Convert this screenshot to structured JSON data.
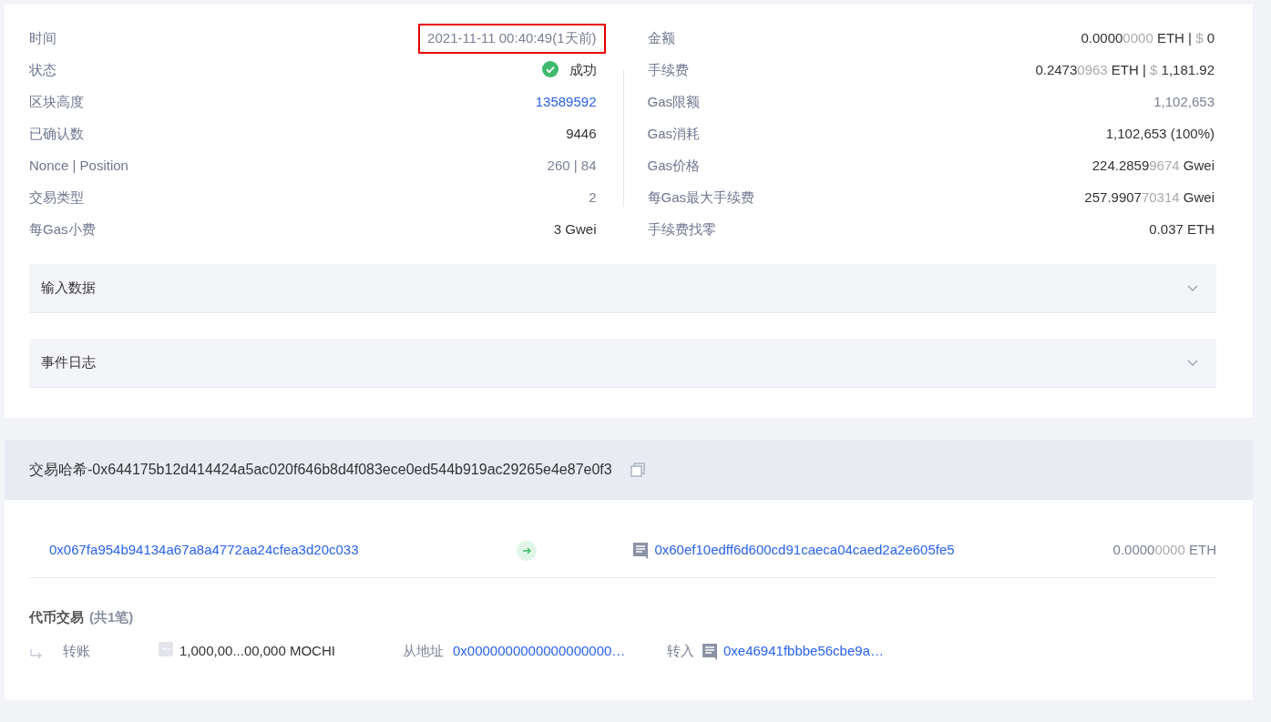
{
  "overview": {
    "left": [
      {
        "label": "时间",
        "kind": "plain",
        "muted": true,
        "highlighted": true,
        "parts": [
          {
            "text": "2021-11-11 00:40:49(1天前)",
            "faint": false
          }
        ]
      },
      {
        "label": "状态",
        "kind": "status",
        "muted": false,
        "highlighted": false,
        "parts": [
          {
            "text": "成功",
            "faint": false
          }
        ]
      },
      {
        "label": "区块高度",
        "kind": "link",
        "highlighted": false,
        "parts": [
          {
            "text": "13589592",
            "faint": false
          }
        ]
      },
      {
        "label": "已确认数",
        "kind": "plain",
        "muted": false,
        "highlighted": false,
        "parts": [
          {
            "text": "9446",
            "faint": false
          }
        ]
      },
      {
        "label": "Nonce | Position",
        "kind": "plain",
        "muted": true,
        "highlighted": false,
        "parts": [
          {
            "text": "260 | 84",
            "faint": false
          }
        ]
      },
      {
        "label": "交易类型",
        "kind": "plain",
        "muted": true,
        "highlighted": false,
        "parts": [
          {
            "text": "2",
            "faint": false
          }
        ]
      },
      {
        "label": "每Gas小费",
        "kind": "plain",
        "muted": false,
        "highlighted": false,
        "parts": [
          {
            "text": "3 Gwei",
            "faint": false
          }
        ]
      }
    ],
    "right": [
      {
        "label": "金额",
        "kind": "plain",
        "muted": false,
        "highlighted": false,
        "parts": [
          {
            "text": "0.0000",
            "faint": false
          },
          {
            "text": "0000",
            "faint": true
          },
          {
            "text": " ETH | ",
            "faint": false
          },
          {
            "text": "$",
            "faint": true
          },
          {
            "text": " 0",
            "faint": false
          }
        ]
      },
      {
        "label": "手续费",
        "kind": "plain",
        "muted": false,
        "highlighted": false,
        "parts": [
          {
            "text": "0.2473",
            "faint": false
          },
          {
            "text": "0963",
            "faint": true
          },
          {
            "text": " ETH | ",
            "faint": false
          },
          {
            "text": "$",
            "faint": true
          },
          {
            "text": " 1,181.92",
            "faint": false
          }
        ]
      },
      {
        "label": "Gas限额",
        "kind": "plain",
        "muted": true,
        "highlighted": false,
        "parts": [
          {
            "text": "1,102,653",
            "faint": false
          }
        ]
      },
      {
        "label": "Gas消耗",
        "kind": "plain",
        "muted": false,
        "highlighted": false,
        "parts": [
          {
            "text": "1,102,653 (100%)",
            "faint": false
          }
        ]
      },
      {
        "label": "Gas价格",
        "kind": "plain",
        "muted": false,
        "highlighted": false,
        "parts": [
          {
            "text": "224.2859",
            "faint": false
          },
          {
            "text": "9674",
            "faint": true
          },
          {
            "text": " Gwei",
            "faint": false
          }
        ]
      },
      {
        "label": "每Gas最大手续费",
        "kind": "plain",
        "muted": false,
        "highlighted": false,
        "parts": [
          {
            "text": "257.9907",
            "faint": false
          },
          {
            "text": "70314",
            "faint": true
          },
          {
            "text": " Gwei",
            "faint": false
          }
        ]
      },
      {
        "label": "手续费找零",
        "kind": "plain",
        "muted": false,
        "highlighted": false,
        "parts": [
          {
            "text": "0.037 ETH",
            "faint": false
          }
        ]
      }
    ]
  },
  "panels": [
    {
      "title": "输入数据",
      "expanded": false
    },
    {
      "title": "事件日志",
      "expanded": false
    }
  ],
  "transaction": {
    "hash_title": "交易哈希-0x644175b12d414424a5ac020f646b8d4f083ece0ed544b919ac29265e4e87e0f3",
    "from": "0x067fa954b94134a67a8a4772aa24cfea3d20c033",
    "to": "0x60ef10edff6d600cd91caeca04caed2a2e605fe5",
    "value": [
      {
        "text": "0.0000",
        "faint": false
      },
      {
        "text": "0000",
        "faint": true
      },
      {
        "text": " ETH",
        "faint": false
      }
    ]
  },
  "token_transfers": {
    "title": "代币交易",
    "count": "(共1笔)",
    "rows": [
      {
        "type": "转账",
        "amount": "1,000,00...00,000 MOCHI",
        "from_label": "从地址",
        "from": "0x0000000000000000000…",
        "to_label": "转入",
        "to": "0xe46941fbbbe56cbe9a…"
      }
    ]
  }
}
